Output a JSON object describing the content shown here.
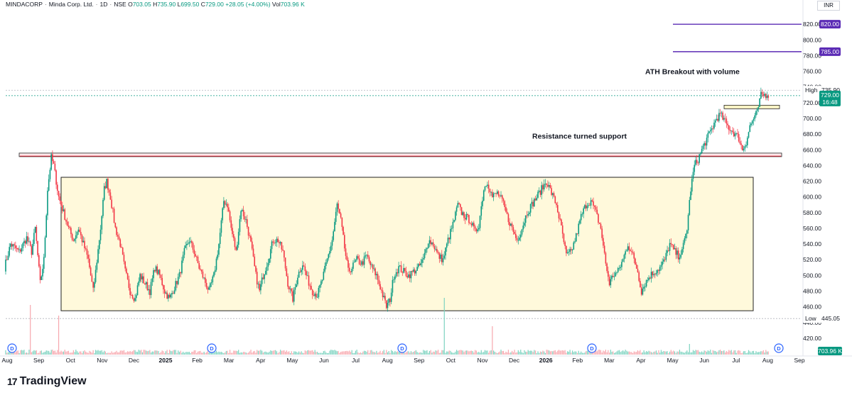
{
  "header": {
    "symbol": "MINDACORP",
    "name": "Minda Corp. Ltd.",
    "interval": "1D",
    "exchange": "NSE",
    "o_label": "O",
    "o": "703.05",
    "h_label": "H",
    "h": "735.90",
    "l_label": "L",
    "l": "699.50",
    "c_label": "C",
    "c": "729.00",
    "change": "+28.05 (+4.00%)",
    "vol_label": "Vol",
    "vol": "703.96 K"
  },
  "currency": "INR",
  "brand": "TradingView",
  "colors": {
    "up": "#089981",
    "down": "#f23645",
    "range_box_fill": "#fff9db",
    "target_line": "#5b2bb5",
    "support_band": "#f23645"
  },
  "chart_data": {
    "type": "candlestick",
    "y_axis": {
      "min": 410,
      "max": 840,
      "ticks": [
        420,
        440,
        460,
        480,
        500,
        520,
        540,
        560,
        580,
        600,
        620,
        640,
        660,
        680,
        700,
        720,
        740,
        760,
        780,
        800,
        820
      ]
    },
    "x_axis": {
      "labels": [
        "Aug",
        "Sep",
        "Oct",
        "Nov",
        "Dec",
        "2025",
        "Feb",
        "Mar",
        "Apr",
        "May",
        "Jun",
        "Jul",
        "Aug",
        "Sep",
        "Oct",
        "Nov",
        "Dec",
        "2026",
        "Feb",
        "Mar",
        "Apr",
        "May",
        "Jun",
        "Jul",
        "Aug",
        "Sep"
      ]
    },
    "price_tags": [
      {
        "text": "820.00",
        "value": 820,
        "kind": "target"
      },
      {
        "text": "785.00",
        "value": 785,
        "kind": "target"
      },
      {
        "text": "735.90",
        "value": 735.9,
        "kind": "high",
        "label": "High"
      },
      {
        "text": "729.00",
        "value": 729,
        "kind": "last",
        "timer": "16:48"
      },
      {
        "text": "445.05",
        "value": 445.05,
        "kind": "low",
        "label": "Low"
      },
      {
        "text": "703.96 K",
        "kind": "volume"
      }
    ],
    "annotations": [
      {
        "text": "ATH Breakout with volume"
      },
      {
        "text": "Resistance turned support"
      }
    ],
    "key_levels": {
      "resistance_support_band": [
        650,
        654
      ],
      "range_box": [
        455,
        625
      ],
      "breakout_box": [
        710,
        715
      ],
      "targets": [
        785,
        820
      ],
      "high": 735.9,
      "low": 445.05
    },
    "anchors": [
      [
        0,
        510
      ],
      [
        5,
        540
      ],
      [
        12,
        530
      ],
      [
        18,
        548
      ],
      [
        22,
        530
      ],
      [
        25,
        560
      ],
      [
        29,
        490
      ],
      [
        32,
        520
      ],
      [
        35,
        610
      ],
      [
        38,
        650
      ],
      [
        40,
        640
      ],
      [
        44,
        600
      ],
      [
        48,
        580
      ],
      [
        52,
        560
      ],
      [
        56,
        545
      ],
      [
        60,
        560
      ],
      [
        64,
        540
      ],
      [
        68,
        520
      ],
      [
        72,
        480
      ],
      [
        74,
        505
      ],
      [
        78,
        560
      ],
      [
        81,
        610
      ],
      [
        83,
        620
      ],
      [
        86,
        600
      ],
      [
        90,
        560
      ],
      [
        94,
        540
      ],
      [
        98,
        505
      ],
      [
        102,
        480
      ],
      [
        106,
        470
      ],
      [
        110,
        500
      ],
      [
        114,
        490
      ],
      [
        118,
        480
      ],
      [
        122,
        510
      ],
      [
        126,
        500
      ],
      [
        130,
        480
      ],
      [
        134,
        470
      ],
      [
        138,
        485
      ],
      [
        142,
        500
      ],
      [
        146,
        530
      ],
      [
        150,
        545
      ],
      [
        154,
        530
      ],
      [
        158,
        510
      ],
      [
        162,
        495
      ],
      [
        166,
        480
      ],
      [
        170,
        500
      ],
      [
        174,
        540
      ],
      [
        178,
        595
      ],
      [
        181,
        590
      ],
      [
        184,
        560
      ],
      [
        188,
        530
      ],
      [
        192,
        585
      ],
      [
        196,
        570
      ],
      [
        200,
        540
      ],
      [
        204,
        500
      ],
      [
        207,
        480
      ],
      [
        210,
        500
      ],
      [
        214,
        520
      ],
      [
        218,
        545
      ],
      [
        222,
        545
      ],
      [
        226,
        530
      ],
      [
        230,
        490
      ],
      [
        234,
        470
      ],
      [
        238,
        500
      ],
      [
        242,
        515
      ],
      [
        246,
        495
      ],
      [
        250,
        480
      ],
      [
        254,
        475
      ],
      [
        258,
        495
      ],
      [
        262,
        520
      ],
      [
        266,
        545
      ],
      [
        270,
        590
      ],
      [
        273,
        570
      ],
      [
        276,
        535
      ],
      [
        279,
        505
      ],
      [
        282,
        510
      ],
      [
        286,
        520
      ],
      [
        290,
        515
      ],
      [
        294,
        525
      ],
      [
        298,
        510
      ],
      [
        302,
        500
      ],
      [
        306,
        480
      ],
      [
        310,
        460
      ],
      [
        313,
        470
      ],
      [
        316,
        500
      ],
      [
        320,
        510
      ],
      [
        324,
        505
      ],
      [
        328,
        500
      ],
      [
        332,
        505
      ],
      [
        336,
        510
      ],
      [
        340,
        520
      ],
      [
        344,
        545
      ],
      [
        348,
        540
      ],
      [
        352,
        525
      ],
      [
        356,
        520
      ],
      [
        360,
        545
      ],
      [
        364,
        565
      ],
      [
        368,
        590
      ],
      [
        371,
        580
      ],
      [
        374,
        575
      ],
      [
        378,
        570
      ],
      [
        382,
        555
      ],
      [
        385,
        565
      ],
      [
        389,
        610
      ],
      [
        392,
        620
      ],
      [
        396,
        600
      ],
      [
        400,
        605
      ],
      [
        404,
        595
      ],
      [
        408,
        575
      ],
      [
        412,
        560
      ],
      [
        416,
        545
      ],
      [
        420,
        560
      ],
      [
        424,
        580
      ],
      [
        428,
        590
      ],
      [
        432,
        600
      ],
      [
        436,
        610
      ],
      [
        440,
        620
      ],
      [
        444,
        605
      ],
      [
        448,
        590
      ],
      [
        452,
        560
      ],
      [
        456,
        525
      ],
      [
        460,
        530
      ],
      [
        464,
        550
      ],
      [
        468,
        575
      ],
      [
        472,
        590
      ],
      [
        476,
        595
      ],
      [
        480,
        580
      ],
      [
        484,
        560
      ],
      [
        488,
        515
      ],
      [
        491,
        490
      ],
      [
        494,
        500
      ],
      [
        498,
        505
      ],
      [
        502,
        520
      ],
      [
        506,
        540
      ],
      [
        510,
        525
      ],
      [
        514,
        505
      ],
      [
        517,
        480
      ],
      [
        520,
        490
      ],
      [
        524,
        500
      ],
      [
        528,
        505
      ],
      [
        532,
        510
      ],
      [
        536,
        520
      ],
      [
        540,
        540
      ],
      [
        544,
        530
      ],
      [
        547,
        525
      ],
      [
        550,
        530
      ],
      [
        554,
        560
      ],
      [
        557,
        610
      ],
      [
        560,
        640
      ],
      [
        563,
        648
      ],
      [
        566,
        660
      ],
      [
        569,
        670
      ],
      [
        572,
        680
      ],
      [
        575,
        690
      ],
      [
        578,
        700
      ],
      [
        581,
        705
      ],
      [
        584,
        698
      ],
      [
        587,
        690
      ],
      [
        590,
        685
      ],
      [
        593,
        680
      ],
      [
        596,
        675
      ],
      [
        599,
        660
      ],
      [
        602,
        670
      ],
      [
        605,
        690
      ],
      [
        608,
        700
      ],
      [
        611,
        708
      ],
      [
        614,
        729
      ]
    ],
    "volume_profile": "small bars along bottom with spikes near Aug, Oct, Jun"
  }
}
